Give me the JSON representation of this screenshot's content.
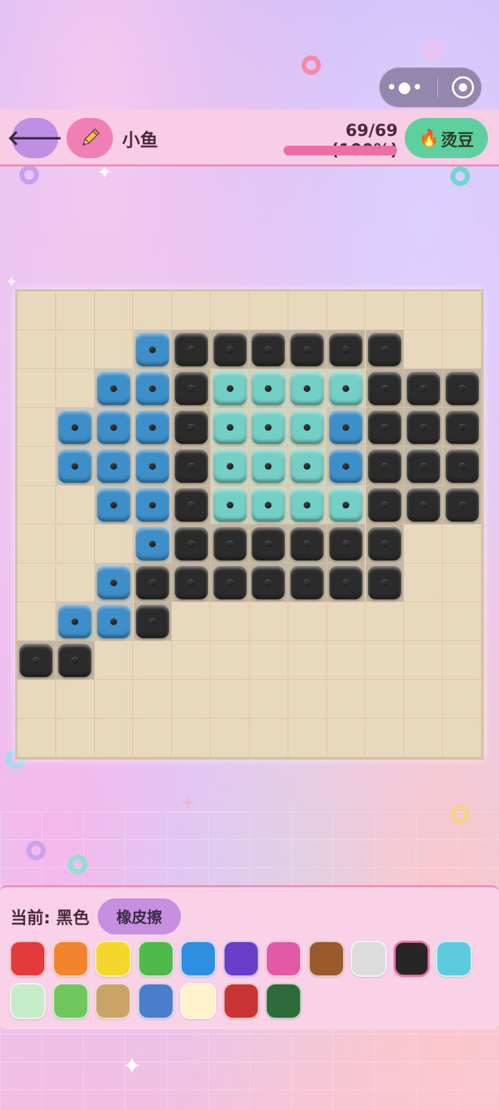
{
  "header": {
    "back_icon": "back-arrow-icon",
    "edit_icon": "pencil-icon",
    "title": "小鱼",
    "progress_text": "69/69 (100%)",
    "progress_fraction": 1.0,
    "hot_icon": "fire-icon",
    "hot_label": "烫豆"
  },
  "capsule": {
    "more_icon": "more-dots-icon",
    "close_icon": "target-close-icon"
  },
  "board": {
    "cols": 12,
    "rows": 12,
    "colors": {
      "K": "#2b2b2b",
      "B": "#3d8fc9",
      "T": "#74cfc5"
    },
    "grid": [
      "............",
      "...BKKKKKK..",
      "..BBKTTTTKKK",
      ".BBBKTTTBKKK",
      ".BBBKTTTBKKK",
      "..BBKTTTTKKK",
      "...BKKKKKK..",
      "..BKKKKKKK..",
      ".BBK........",
      "KK..........",
      "............",
      "............"
    ]
  },
  "panel": {
    "current_label": "当前: 黑色",
    "eraser_label": "橡皮擦",
    "selected_index": 9,
    "swatches": [
      "#e33b3b",
      "#f3842f",
      "#f5d62d",
      "#4fb94a",
      "#2e8fe0",
      "#6a3ec9",
      "#e05aa6",
      "#9b5a2c",
      "#dcdcdc",
      "#262626",
      "#5ccbe0",
      "#c6ecca",
      "#6fc75d",
      "#c9a466",
      "#4a7ecb",
      "#fff1cc",
      "#c93535",
      "#2f6a3a"
    ]
  }
}
